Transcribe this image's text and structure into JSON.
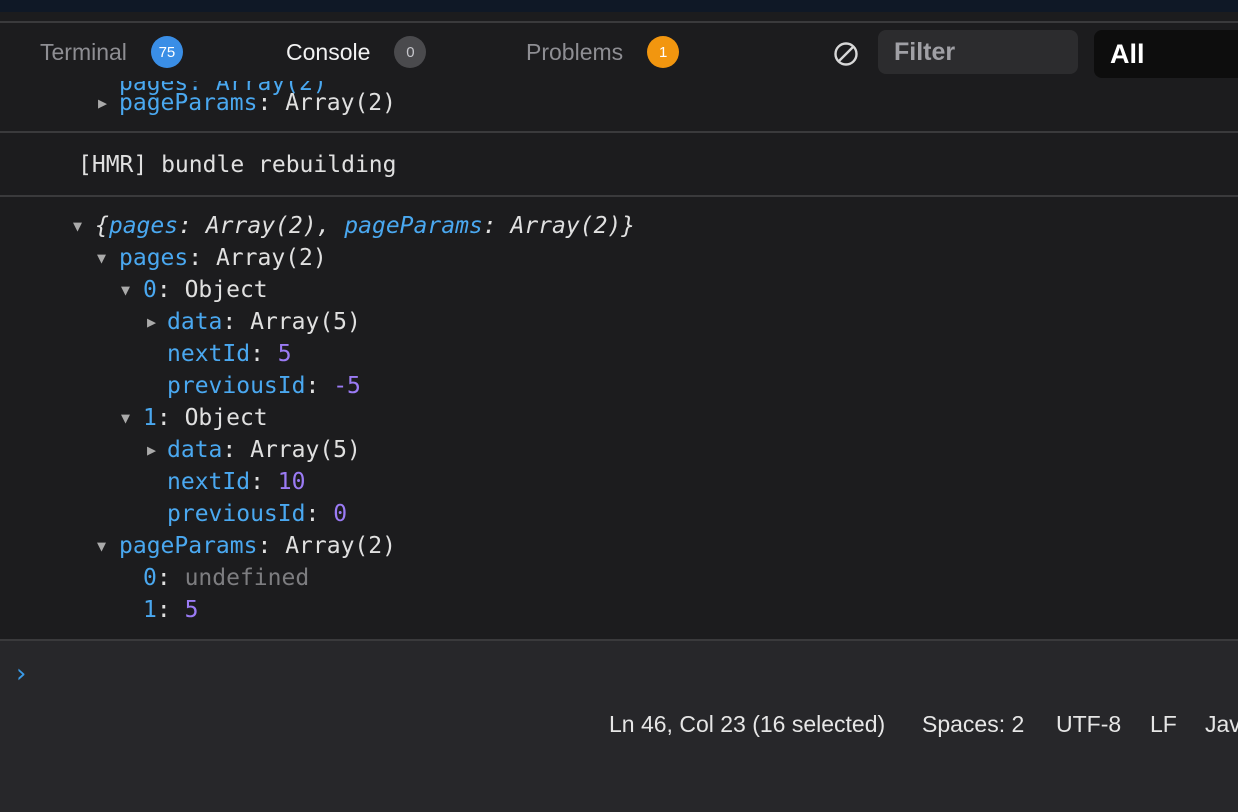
{
  "tabs": [
    {
      "label": "Terminal",
      "count": "75",
      "active": false
    },
    {
      "label": "Console",
      "count": "0",
      "active": true
    },
    {
      "label": "Problems",
      "count": "1",
      "active": false
    }
  ],
  "toolbar": {
    "filter_placeholder": "Filter",
    "level_value": "All"
  },
  "console": {
    "prev_entry": {
      "key": "pageParams",
      "value": "Array(2)"
    },
    "hmr_message": "[HMR] bundle rebuilding",
    "object_summary": {
      "open": "{",
      "k1": "pages",
      "v1": "Array(2)",
      "k2": "pageParams",
      "v2": "Array(2)",
      "close": "}"
    },
    "pages": {
      "key": "pages",
      "value": "Array(2)",
      "items": [
        {
          "index": "0",
          "type": "Object",
          "data_key": "data",
          "data_value": "Array(5)",
          "next_key": "nextId",
          "next_value": "5",
          "prev_key": "previousId",
          "prev_value": "-5"
        },
        {
          "index": "1",
          "type": "Object",
          "data_key": "data",
          "data_value": "Array(5)",
          "next_key": "nextId",
          "next_value": "10",
          "prev_key": "previousId",
          "prev_value": "0"
        }
      ]
    },
    "pageParams": {
      "key": "pageParams",
      "value": "Array(2)",
      "items": [
        {
          "index": "0",
          "value": "undefined"
        },
        {
          "index": "1",
          "value": "5"
        }
      ]
    }
  },
  "prompt_symbol": "›",
  "status_bar": {
    "position": "Ln 46, Col 23 (16 selected)",
    "spaces": "Spaces: 2",
    "encoding": "UTF-8",
    "eol": "LF",
    "language": "Jav"
  }
}
